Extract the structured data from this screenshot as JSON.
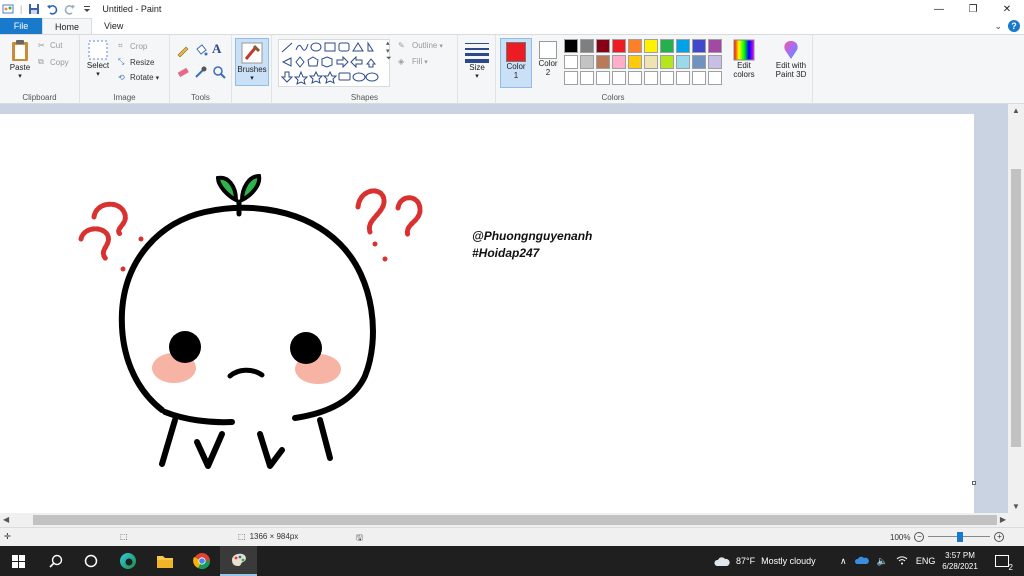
{
  "window": {
    "title": "Untitled - Paint",
    "controls": {
      "minimize": "—",
      "maximize": "❐",
      "close": "✕"
    }
  },
  "tabs": [
    {
      "label": "File"
    },
    {
      "label": "Home"
    },
    {
      "label": "View"
    }
  ],
  "help_icon": "?",
  "ribbon": {
    "clipboard": {
      "paste": "Paste",
      "cut": "Cut",
      "copy": "Copy",
      "label": "Clipboard"
    },
    "image": {
      "select": "Select",
      "crop": "Crop",
      "resize": "Resize",
      "rotate": "Rotate",
      "label": "Image"
    },
    "tools": {
      "label": "Tools"
    },
    "brushes": {
      "label": "Brushes"
    },
    "shapes": {
      "outline": "Outline",
      "fill": "Fill",
      "label": "Shapes"
    },
    "size": {
      "label": "Size"
    },
    "color1": {
      "label": "Color",
      "num": "1",
      "color": "#ed1c24"
    },
    "color2": {
      "label": "Color",
      "num": "2",
      "color": "#ffffff"
    },
    "colors": {
      "label": "Colors",
      "row1": [
        "#000000",
        "#7f7f7f",
        "#880015",
        "#ed1c24",
        "#ff7f27",
        "#fff200",
        "#22b14c",
        "#00a2e8",
        "#3f48cc",
        "#a349a4"
      ],
      "row2": [
        "#ffffff",
        "#c3c3c3",
        "#b97a57",
        "#ffaec9",
        "#ffc90e",
        "#efe4b0",
        "#b5e61d",
        "#99d9ea",
        "#7092be",
        "#c8bfe7"
      ],
      "row3": [
        "#ffffff",
        "#ffffff",
        "#ffffff",
        "#ffffff",
        "#ffffff",
        "#ffffff",
        "#ffffff",
        "#ffffff",
        "#ffffff",
        "#ffffff"
      ]
    },
    "edit_colors": {
      "line1": "Edit",
      "line2": "colors"
    },
    "paint3d": {
      "line1": "Edit with",
      "line2": "Paint 3D"
    }
  },
  "canvas": {
    "text_line1": "@Phuongnguyenanh",
    "text_line2": "#Hoidap247"
  },
  "statusbar": {
    "dimensions": "1366 × 984px",
    "zoom": "100%"
  },
  "taskbar": {
    "weather_temp": "87°F",
    "weather_desc": "Mostly cloudy",
    "language": "ENG",
    "time": "3:57 PM",
    "date": "6/28/2021",
    "notifications": "2"
  }
}
